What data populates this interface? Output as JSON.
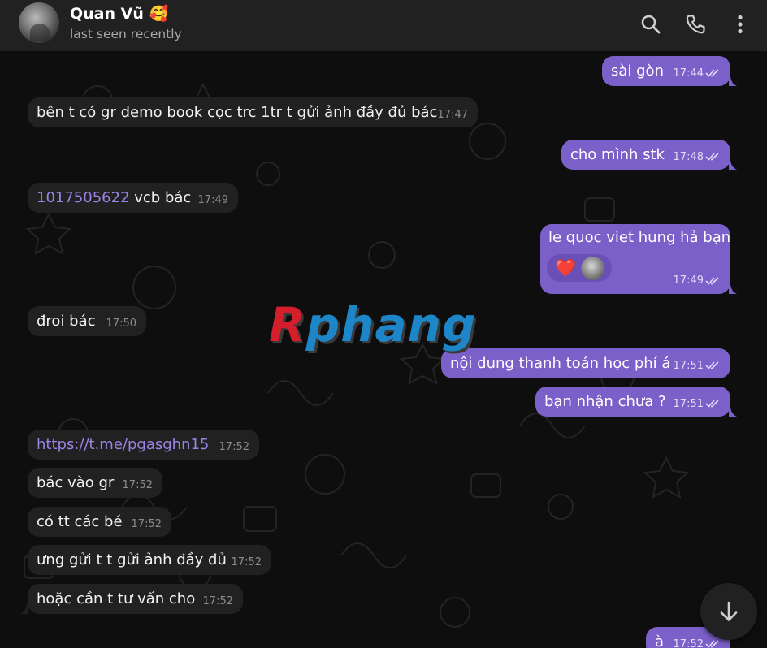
{
  "header": {
    "contact_name": "Quan Vũ 🥰",
    "status": "last seen recently"
  },
  "icons": {
    "search": "search-icon",
    "call": "phone-icon",
    "more": "more-vertical-icon",
    "scroll_down": "arrow-down-icon",
    "read_receipt": "double-check-icon"
  },
  "colors": {
    "outgoing_bubble": "#7b60c9",
    "incoming_bubble": "#212121",
    "link": "#9a84e4",
    "header": "#212121"
  },
  "watermark": {
    "first": "R",
    "rest": "phang"
  },
  "messages": [
    {
      "dir": "out",
      "text": "sài gòn",
      "time": "17:44",
      "status": "read"
    },
    {
      "dir": "in",
      "text": "bên t có gr demo book cọc trc 1tr t gửi ảnh đầy đủ bác",
      "time": "17:47"
    },
    {
      "dir": "out",
      "text": "cho mình stk",
      "time": "17:48",
      "status": "read"
    },
    {
      "dir": "in",
      "link": "1017505622",
      "text": " vcb bác",
      "time": "17:49"
    },
    {
      "dir": "out",
      "text": "le quoc viet hung hả bạn",
      "time": "17:49",
      "status": "read",
      "reaction": "❤️"
    },
    {
      "dir": "in",
      "text": "đroi bác",
      "time": "17:50"
    },
    {
      "dir": "out",
      "text": "nội dung thanh toán học phí á",
      "time": "17:51",
      "status": "read"
    },
    {
      "dir": "out",
      "text": "bạn nhận chưa ?",
      "time": "17:51",
      "status": "read"
    },
    {
      "dir": "in",
      "link": "https://t.me/pgasghn15",
      "time": "17:52"
    },
    {
      "dir": "in",
      "text": "bác vào gr",
      "time": "17:52"
    },
    {
      "dir": "in",
      "text": "có tt các bé",
      "time": "17:52"
    },
    {
      "dir": "in",
      "text": "ưng gửi t t gửi ảnh đầy đủ",
      "time": "17:52"
    },
    {
      "dir": "in",
      "text": "hoặc cần t tư vấn cho",
      "time": "17:52"
    },
    {
      "dir": "out",
      "text": "à",
      "time": "17:52",
      "status": "read"
    }
  ]
}
